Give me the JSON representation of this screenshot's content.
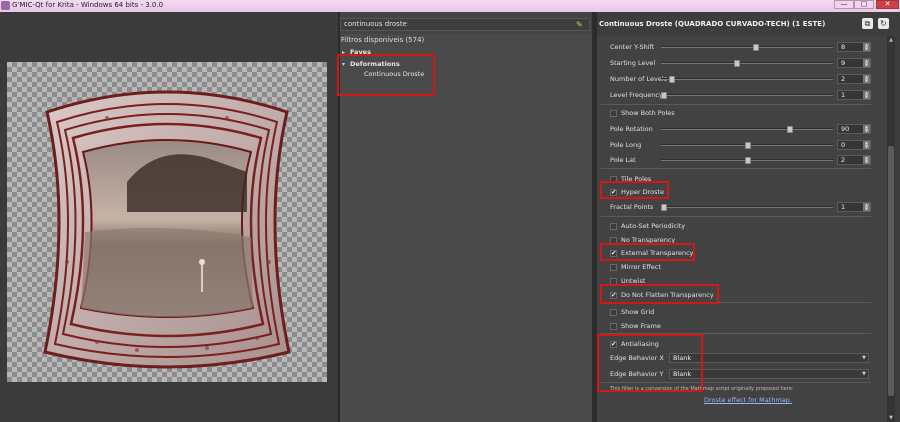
{
  "window": {
    "title": "G'MIC-Qt for Krita - Windows 64 bits - 3.0.0",
    "minimize": "—",
    "maximize": "□",
    "close": "✕"
  },
  "filters": {
    "search_value": "continuous droste",
    "header": "Filtros disponíveis (574)",
    "items": [
      {
        "label": "Faves",
        "arrow": "▸"
      },
      {
        "label": "Deformations",
        "arrow": "▾"
      },
      {
        "label": "Continuous Droste"
      }
    ]
  },
  "params": {
    "title": "Continuous Droste (QUADRADO CURVADO-TECH) (1 ESTE)",
    "sliders": [
      {
        "label": "Center Y-Shift",
        "value": "8",
        "pos": 0.55
      },
      {
        "label": "Starting Level",
        "value": "9",
        "pos": 0.45
      },
      {
        "label": "Number of Levels",
        "value": "2",
        "pos": 0.06
      },
      {
        "label": "Level Frequency",
        "value": "1",
        "pos": 0.0
      },
      {
        "label": "Pole Rotation",
        "value": "90",
        "pos": 0.75
      },
      {
        "label": "Pole Long",
        "value": "0",
        "pos": 0.5
      },
      {
        "label": "Pole Lat",
        "value": "2",
        "pos": 0.5
      },
      {
        "label": "Fractal Points",
        "value": "1",
        "pos": 0.0
      }
    ],
    "checks": [
      {
        "label": "Show Both Poles",
        "checked": false
      },
      {
        "label": "Tile Poles",
        "checked": false
      },
      {
        "label": "Hyper Droste",
        "checked": true
      },
      {
        "label": "Auto-Set Periodicity",
        "checked": false
      },
      {
        "label": "No Transparency",
        "checked": false
      },
      {
        "label": "External Transparency",
        "checked": true
      },
      {
        "label": "Mirror Effect",
        "checked": false
      },
      {
        "label": "Untwist",
        "checked": false
      },
      {
        "label": "Do Not Flatten Transparency",
        "checked": true
      },
      {
        "label": "Show Grid",
        "checked": false
      },
      {
        "label": "Show Frame",
        "checked": false
      },
      {
        "label": "Antialiasing",
        "checked": true
      }
    ],
    "combos": [
      {
        "label": "Edge Behavior X",
        "value": "Blank"
      },
      {
        "label": "Edge Behavior Y",
        "value": "Blank"
      }
    ],
    "note": "This filter is a conversion of the Mathmap script originally proposed here:",
    "link": "Droste effect for Mathmap."
  }
}
